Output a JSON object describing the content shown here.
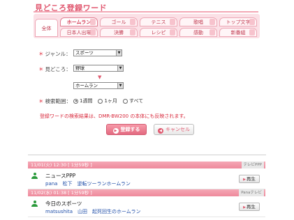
{
  "page": {
    "title": "見どころ登録ワード"
  },
  "tabs": {
    "all_label": "全体",
    "row1": [
      "ホームラン",
      "ゴール",
      "テニス",
      "歌唱",
      "トップ文字"
    ],
    "row2": [
      "日本人出場",
      "決勝",
      "レシピ",
      "感動",
      "新番組"
    ]
  },
  "form": {
    "genre": {
      "label": "ジャンル：",
      "value": "スポーツ"
    },
    "midokoro": {
      "label": "見どころ：",
      "value1": "野球",
      "value2": "ホームラン"
    },
    "period": {
      "label": "検索範囲：",
      "options": [
        "1週間",
        "1ヶ月",
        "すべて"
      ],
      "selected": "1週間"
    },
    "arrow": "▼",
    "notice": "登録ワードの検索結果は、DMR-BW200 の本体にも反映されます。"
  },
  "buttons": {
    "register": "登録する",
    "cancel": "キャンセル",
    "register_icon": "▶",
    "cancel_icon": "◀"
  },
  "recordings": [
    {
      "time": "11/01(火) 12:30 [ 1分59秒 ]",
      "channel": "テレビPPP",
      "title": "ニュースPPP",
      "desc": "pana　松下　逆転ツーランホームラン",
      "play": "再生"
    },
    {
      "time": "11/02(水) 01:38 [ 1分59秒 ]",
      "channel": "Panaテレビ",
      "title": "今日のスポーツ",
      "desc": "matsushita　山田　起死回生のホームラン",
      "play": "再生"
    }
  ],
  "colors": {
    "accent": "#e0566e",
    "tab_bg": "#fbe0e6",
    "link": "#1f4ea8",
    "notice": "#d8283b"
  }
}
